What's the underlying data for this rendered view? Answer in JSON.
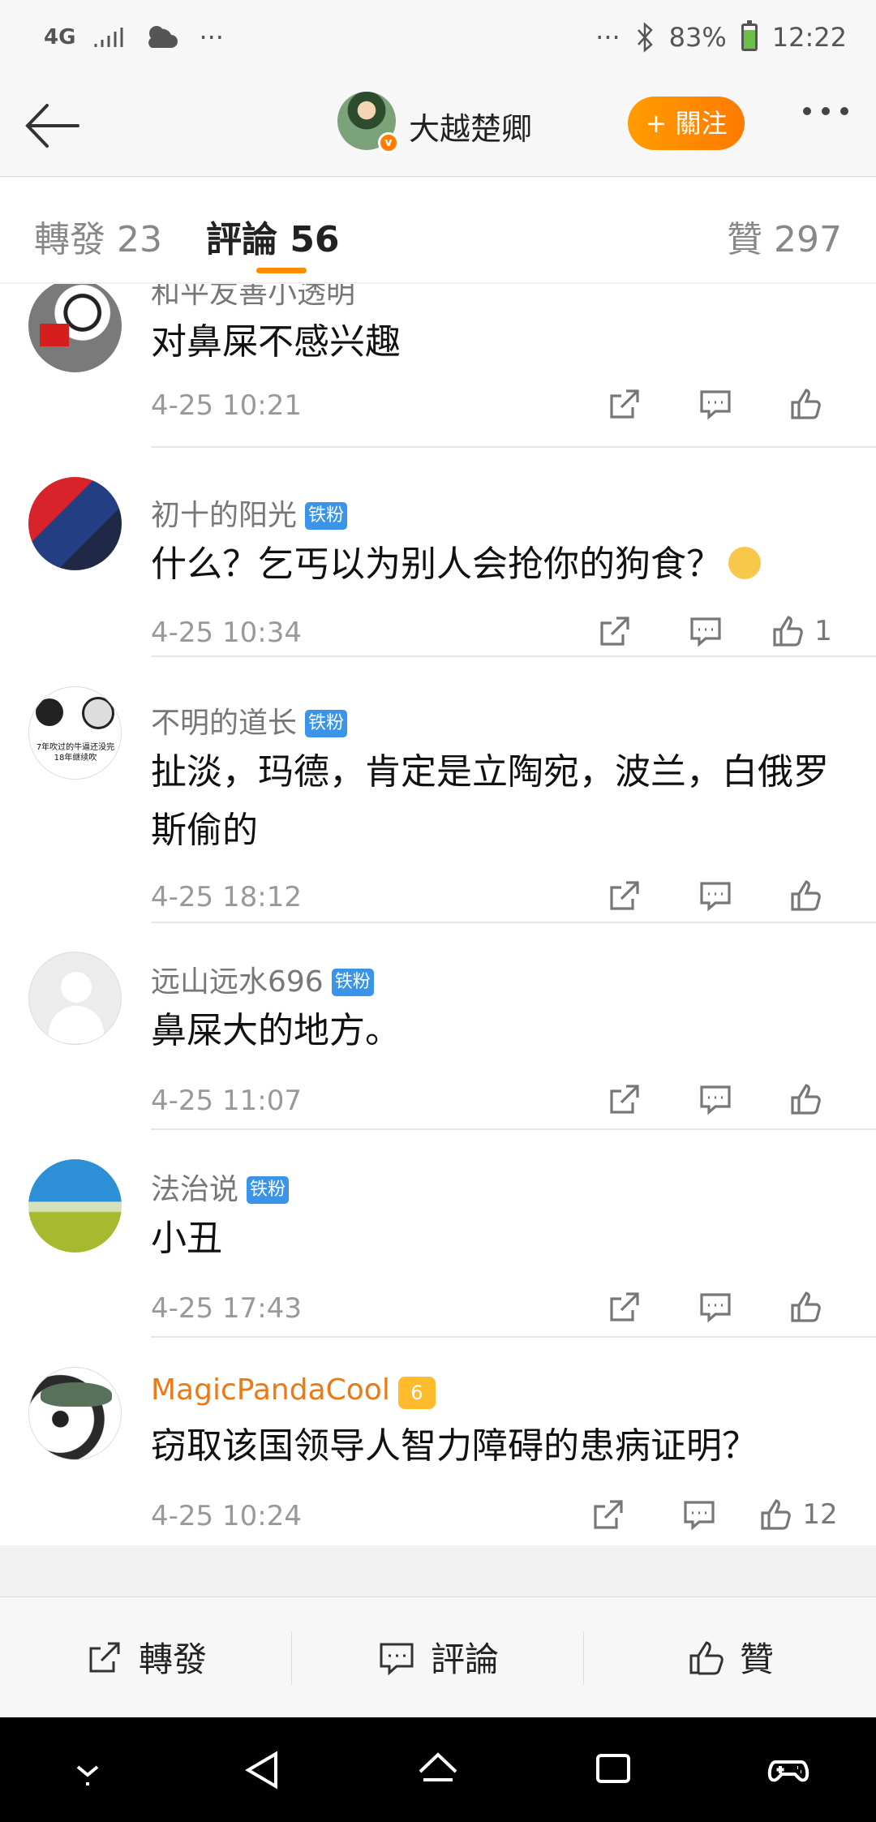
{
  "status": {
    "network": "4G",
    "signal": "signal-bars",
    "weather": "partly-cloudy-icon",
    "dots": "···",
    "bluetooth": "bluetooth-icon",
    "battery": "83%",
    "time": "12:22"
  },
  "nav": {
    "title": "大越楚卿",
    "follow": "+ 關注"
  },
  "tabs": {
    "reposts": "轉發 23",
    "comments": "評論 56",
    "likes": "贊 297"
  },
  "comments": [
    {
      "username": "和平友善小透明",
      "text": "对鼻屎不感兴趣",
      "time": "4-25 10:21",
      "likes": "",
      "badge": ""
    },
    {
      "username": "初十的阳光",
      "text": "什么？乞丐以为别人会抢你的狗食？",
      "time": "4-25 10:34",
      "likes": "1",
      "badge": "铁粉"
    },
    {
      "username": "不明的道长",
      "text": "扯淡，玛德，肯定是立陶宛，波兰，白俄罗斯偷的",
      "time": "4-25 18:12",
      "likes": "",
      "badge": "铁粉",
      "avatar_text_1": "7年吹过的牛逼还没完",
      "avatar_text_2": "18年继续吹"
    },
    {
      "username": "远山远水696",
      "text": "鼻屎大的地方。",
      "time": "4-25 11:07",
      "likes": "",
      "badge": "铁粉"
    },
    {
      "username": "法治说",
      "text": "小丑",
      "time": "4-25 17:43",
      "likes": "",
      "badge": "铁粉"
    },
    {
      "username": "MagicPandaCool",
      "text": "窃取该国领导人智力障碍的患病证明？",
      "time": "4-25 10:24",
      "likes": "12",
      "badge": "6"
    }
  ],
  "bottom": {
    "repost": "轉發",
    "comment": "評論",
    "like": "贊"
  }
}
